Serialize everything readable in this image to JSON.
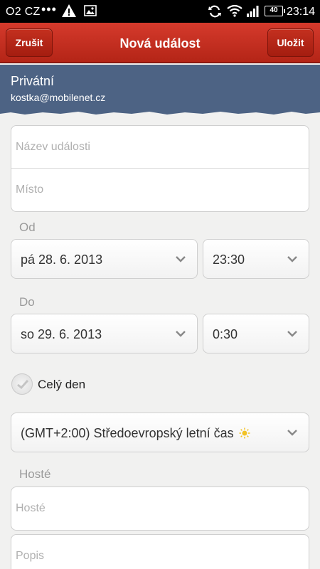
{
  "status_bar": {
    "carrier": "O2 CZ",
    "dots": "•••",
    "battery": "40",
    "time": "23:14"
  },
  "title_bar": {
    "cancel_label": "Zrušit",
    "title": "Nová událost",
    "save_label": "Uložit"
  },
  "account": {
    "name": "Privátní",
    "email": "kostka@mobilenet.cz"
  },
  "form": {
    "event_name_placeholder": "Název události",
    "location_placeholder": "Místo",
    "from_label": "Od",
    "from_date": "pá 28. 6. 2013",
    "from_time": "23:30",
    "to_label": "Do",
    "to_date": "so 29. 6. 2013",
    "to_time": "0:30",
    "all_day_label": "Celý den",
    "all_day_checked": false,
    "timezone": "(GMT+2:00) Středoevropský letní čas",
    "guests_label": "Hosté",
    "guests_placeholder": "Hosté",
    "description_placeholder": "Popis"
  },
  "icons": [
    "warning-icon",
    "image-icon",
    "sync-icon",
    "wifi-icon",
    "signal-icon",
    "battery-icon",
    "chevron-down-icon",
    "check-icon",
    "sun-icon"
  ]
}
